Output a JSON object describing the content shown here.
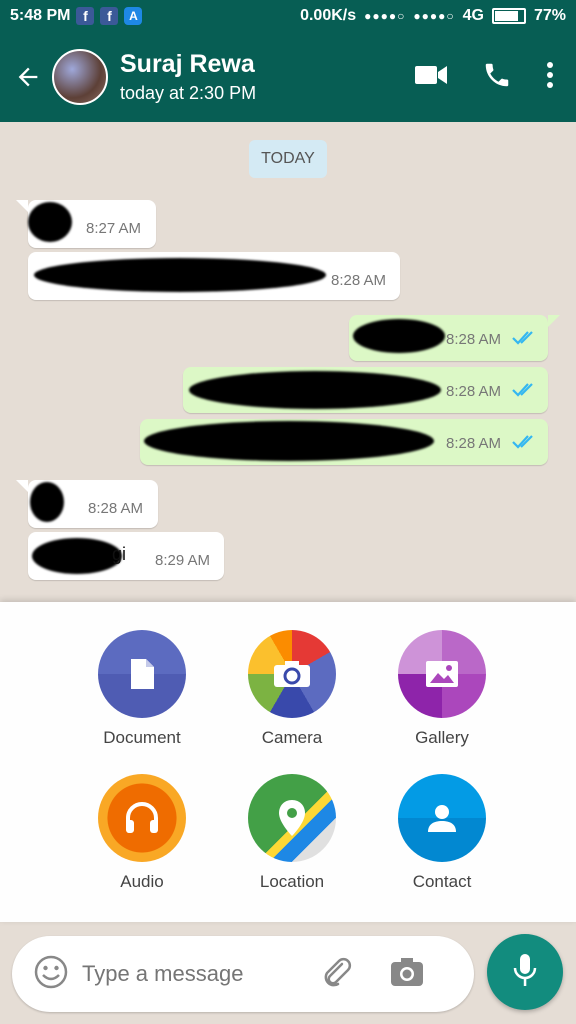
{
  "status_bar": {
    "time": "5:48 PM",
    "network_speed": "0.00K/s",
    "signal1": "●●●●○",
    "signal2": "●●●●○",
    "network_type": "4G",
    "battery_percent": "77%",
    "battery_level": 0.77,
    "notification_icons": [
      "facebook-icon",
      "facebook-icon",
      "app-store-icon"
    ]
  },
  "header": {
    "contact_name": "Suraj Rewa",
    "last_seen": "today at 2:30 PM",
    "colors": {
      "primary": "#075e54",
      "accent": "#128c7e"
    }
  },
  "chat": {
    "date_divider": "TODAY",
    "messages": [
      {
        "direction": "in",
        "text": "",
        "time": "8:27 AM"
      },
      {
        "direction": "in",
        "text": "",
        "time": "8:28 AM"
      },
      {
        "direction": "out",
        "text": "",
        "time": "8:28 AM",
        "status": "read"
      },
      {
        "direction": "out",
        "text": "",
        "time": "8:28 AM",
        "status": "read"
      },
      {
        "direction": "out",
        "text": "",
        "time": "8:28 AM",
        "status": "read"
      },
      {
        "direction": "in",
        "text": "",
        "time": "8:28 AM"
      },
      {
        "direction": "in",
        "text": "gi",
        "time": "8:29 AM"
      }
    ]
  },
  "attach_menu": {
    "items": [
      {
        "label": "Document",
        "icon": "document-icon",
        "color": "#5c6bc0"
      },
      {
        "label": "Camera",
        "icon": "camera-icon",
        "color": "#e53935"
      },
      {
        "label": "Gallery",
        "icon": "gallery-icon",
        "color": "#ab47bc"
      },
      {
        "label": "Audio",
        "icon": "headphones-icon",
        "color": "#f57c00"
      },
      {
        "label": "Location",
        "icon": "location-pin-icon",
        "color": "#43a047"
      },
      {
        "label": "Contact",
        "icon": "contact-icon",
        "color": "#039be5"
      }
    ]
  },
  "composer": {
    "placeholder": "Type a message"
  }
}
